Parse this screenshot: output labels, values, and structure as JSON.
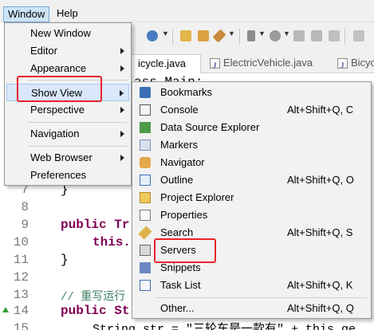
{
  "menubar": {
    "items": [
      {
        "label": "Window",
        "active": true
      },
      {
        "label": "Help",
        "active": false
      }
    ]
  },
  "tabs": [
    {
      "label": "icycle.java",
      "active": true
    },
    {
      "label": "ElectricVehicle.java",
      "active": false
    },
    {
      "label": "Bicycle",
      "active": false
    }
  ],
  "editor": {
    "fragment_top": "ass Main:",
    "lines": [
      {
        "num": "7",
        "text": "}"
      },
      {
        "num": "8",
        "text": ""
      },
      {
        "num": "9",
        "text": "public Tr"
      },
      {
        "num": "10",
        "text": "this."
      },
      {
        "num": "11",
        "text": "}"
      },
      {
        "num": "12",
        "text": ""
      },
      {
        "num": "13",
        "text": "// 重写运行"
      },
      {
        "num": "14",
        "text": "public St"
      },
      {
        "num": "15",
        "text": "String str = \"三轮车是一款有\" + this.ge"
      }
    ]
  },
  "window_menu": {
    "items": [
      {
        "label": "New Window",
        "submenu": false
      },
      {
        "label": "Editor",
        "submenu": true
      },
      {
        "label": "Appearance",
        "submenu": true
      },
      {
        "label": "Show View",
        "submenu": true,
        "selected": true
      },
      {
        "label": "Perspective",
        "submenu": true
      },
      {
        "label": "Navigation",
        "submenu": true
      },
      {
        "label": "Web Browser",
        "submenu": true
      },
      {
        "label": "Preferences",
        "submenu": false
      }
    ]
  },
  "show_view_menu": {
    "items": [
      {
        "label": "Bookmarks",
        "shortcut": "",
        "icon": "bookmarks-icon"
      },
      {
        "label": "Console",
        "shortcut": "Alt+Shift+Q, C",
        "icon": "console-icon"
      },
      {
        "label": "Data Source Explorer",
        "shortcut": "",
        "icon": "data-source-explorer-icon"
      },
      {
        "label": "Markers",
        "shortcut": "",
        "icon": "markers-icon"
      },
      {
        "label": "Navigator",
        "shortcut": "",
        "icon": "navigator-icon"
      },
      {
        "label": "Outline",
        "shortcut": "Alt+Shift+Q, O",
        "icon": "outline-icon"
      },
      {
        "label": "Project Explorer",
        "shortcut": "",
        "icon": "project-explorer-icon"
      },
      {
        "label": "Properties",
        "shortcut": "",
        "icon": "properties-icon"
      },
      {
        "label": "Search",
        "shortcut": "Alt+Shift+Q, S",
        "icon": "search-icon"
      },
      {
        "label": "Servers",
        "shortcut": "",
        "icon": "servers-icon"
      },
      {
        "label": "Snippets",
        "shortcut": "",
        "icon": "snippets-icon"
      },
      {
        "label": "Task List",
        "shortcut": "Alt+Shift+Q, K",
        "icon": "task-list-icon"
      },
      {
        "label": "Other...",
        "shortcut": "Alt+Shift+Q, Q",
        "icon": ""
      }
    ]
  },
  "colors": {
    "highlight_box": "#e8242c",
    "keyword": "#7f0055",
    "comment": "#3f7f5f",
    "string": "#2a00ff",
    "menu_selected": "#d9e8fb"
  }
}
